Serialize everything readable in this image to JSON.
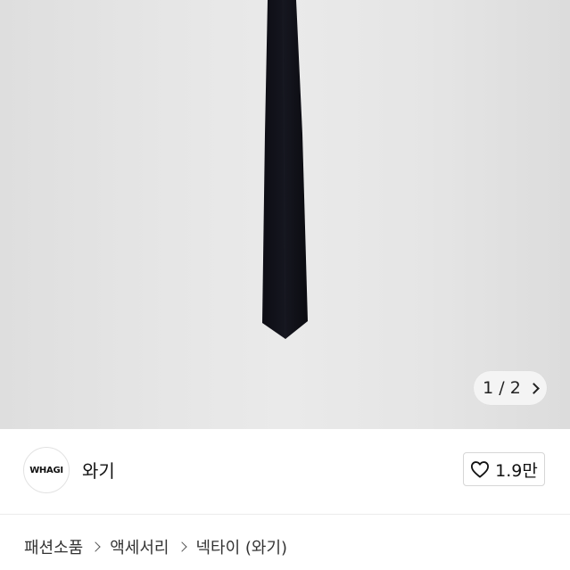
{
  "gallery": {
    "counter": "1 / 2",
    "next_icon": "chevron-right-icon"
  },
  "seller": {
    "avatar_text": "WHAGI",
    "name": "와기"
  },
  "like": {
    "icon": "heart-outline-icon",
    "count": "1.9만"
  },
  "breadcrumb": {
    "items": [
      "패션소품",
      "액세서리",
      "넥타이 (와기)"
    ],
    "separator_icon": "chevron-right-icon"
  }
}
